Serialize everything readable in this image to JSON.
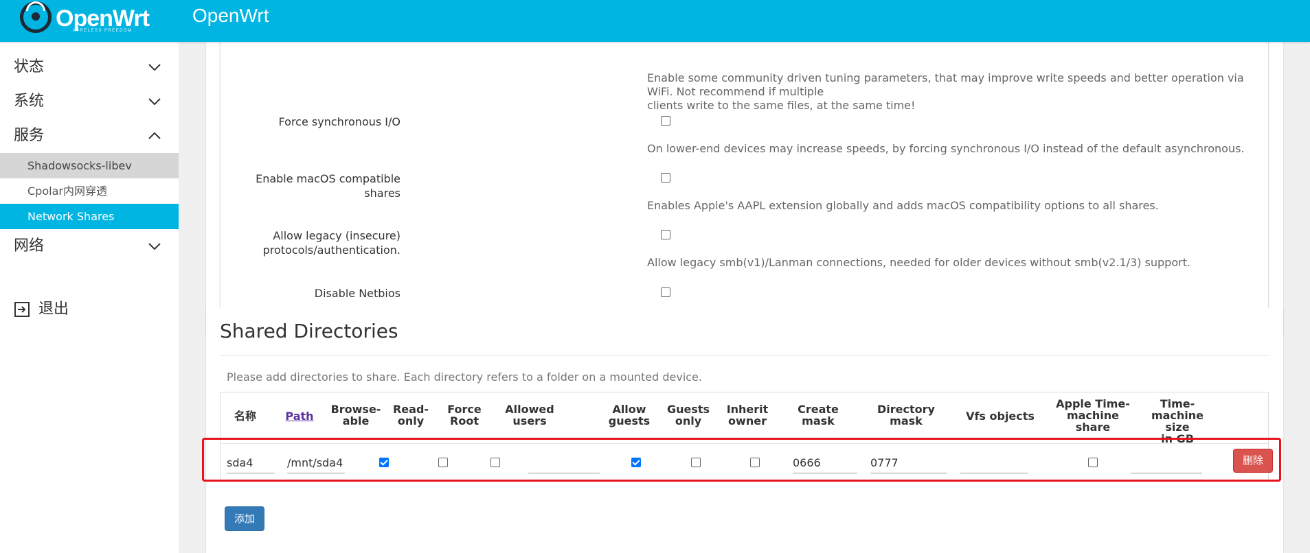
{
  "header": {
    "logo_text": "OpenWrt",
    "logo_sub": "WIRELESS FREEDOM",
    "brand": "OpenWrt"
  },
  "sidebar": {
    "items": [
      {
        "label": "状态"
      },
      {
        "label": "系统"
      },
      {
        "label": "服务"
      },
      {
        "label": "网络"
      }
    ],
    "service_sub": [
      {
        "label": "Shadowsocks-libev"
      },
      {
        "label": "Cpolar内网穿透"
      },
      {
        "label": "Network Shares"
      }
    ],
    "logout": "退出"
  },
  "settings": {
    "tuning_desc_line1": "Enable some community driven tuning parameters, that may improve write speeds and better operation via WiFi. Not recommend if multiple",
    "tuning_desc_line2": "clients write to the same files, at the same time!",
    "force_sync_label": "Force synchronous I/O",
    "force_sync_desc": "On lower-end devices may increase speeds, by forcing synchronous I/O instead of the default asynchronous.",
    "macos_label": "Enable macOS compatible shares",
    "macos_desc": "Enables Apple's AAPL extension globally and adds macOS compatibility options to all shares.",
    "legacy_label_line1": "Allow legacy (insecure)",
    "legacy_label_line2": "protocols/authentication.",
    "legacy_desc": "Allow legacy smb(v1)/Lanman connections, needed for older devices without smb(v2.1/3) support.",
    "netbios_label": "Disable Netbios"
  },
  "shares": {
    "title": "Shared Directories",
    "description": "Please add directories to share. Each directory refers to a folder on a mounted device.",
    "columns": {
      "name": "名称",
      "path": "Path",
      "browseable": [
        "Browse-",
        "able"
      ],
      "readonly": [
        "Read-",
        "only"
      ],
      "forceroot": [
        "Force",
        "Root"
      ],
      "allowed_users": [
        "Allowed",
        "users"
      ],
      "allow_guests": [
        "Allow",
        "guests"
      ],
      "guests_only": [
        "Guests",
        "only"
      ],
      "inherit_owner": [
        "Inherit",
        "owner"
      ],
      "create_mask": [
        "Create",
        "mask"
      ],
      "directory_mask": [
        "Directory",
        "mask"
      ],
      "vfs_objects": "Vfs objects",
      "timemachine": [
        "Apple Time-",
        "machine",
        "share"
      ],
      "timemachine_size": [
        "Time-",
        "machine size",
        "in GB"
      ]
    },
    "row": {
      "name": "sda4",
      "path": "/mnt/sda4",
      "browseable": true,
      "readonly": false,
      "forceroot": false,
      "allowed_users": "",
      "allow_guests": true,
      "guests_only": false,
      "inherit_owner": false,
      "create_mask": "0666",
      "directory_mask": "0777",
      "vfs_objects": "",
      "timemachine": false,
      "timemachine_size": ""
    },
    "delete_label": "删除",
    "add_label": "添加"
  },
  "colors": {
    "accent": "#00b5e2",
    "danger": "#d9534f",
    "primary": "#337ab7",
    "highlight": "#e8121c"
  }
}
